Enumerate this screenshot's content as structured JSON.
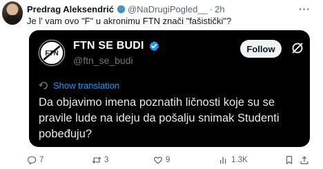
{
  "post": {
    "display_name": "Predrag Aleksendrić",
    "handle": "@NaDrugiPogled__",
    "separator": "·",
    "time": "2h",
    "more": "···",
    "text": "Je l' vam ovo \"F\" u akronimu FTN znači \"fašistički\"?"
  },
  "quote": {
    "name": "FTN SE BUDI",
    "handle": "@ftn_se_budi",
    "follow_label": "Follow",
    "translate_label": "Show translation",
    "text": "Da objavimo imena poznatih ličnosti koje su se pravile lude na ideju da pošalju snimak Studenti pobeđuju?",
    "logo_text": "FTN",
    "colors": {
      "background": "#000000",
      "accent": "#1d9bf0"
    }
  },
  "actions": {
    "replies": "7",
    "reposts": "3",
    "likes": "9",
    "views": "1.3K"
  },
  "icons": [
    "globe-icon",
    "more-icon",
    "verified-icon",
    "grok-icon",
    "translate-icon",
    "reply-icon",
    "repost-icon",
    "like-icon",
    "views-icon",
    "bookmark-icon",
    "share-icon"
  ]
}
